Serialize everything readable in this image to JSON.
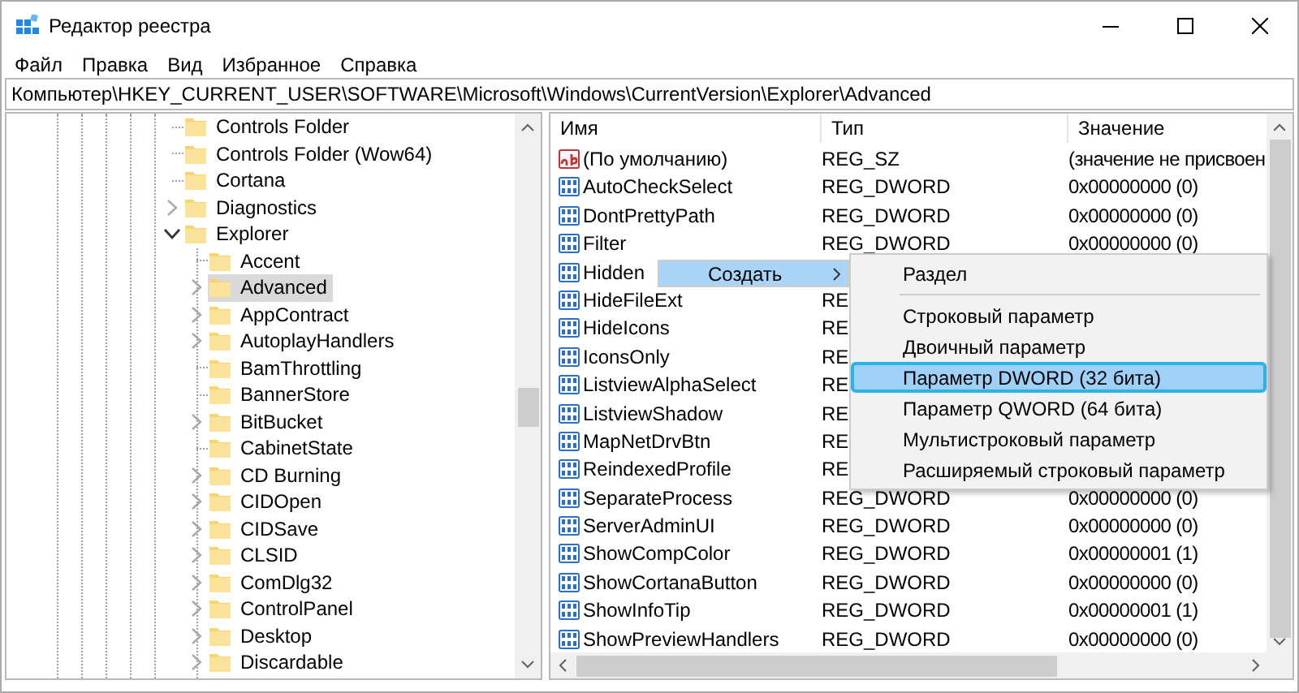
{
  "window": {
    "title": "Редактор реестра"
  },
  "menu": [
    "Файл",
    "Правка",
    "Вид",
    "Избранное",
    "Справка"
  ],
  "address": "Компьютер\\HKEY_CURRENT_USER\\SOFTWARE\\Microsoft\\Windows\\CurrentVersion\\Explorer\\Advanced",
  "tree": [
    {
      "label": "Controls Folder",
      "expandable": false,
      "selected": false
    },
    {
      "label": "Controls Folder (Wow64)",
      "expandable": false,
      "selected": false
    },
    {
      "label": "Cortana",
      "expandable": false,
      "selected": false
    },
    {
      "label": "Diagnostics",
      "expandable": true,
      "expanded": false,
      "selected": false
    },
    {
      "label": "Explorer",
      "expandable": true,
      "expanded": true,
      "selected": false,
      "children": [
        {
          "label": "Accent",
          "expandable": false,
          "selected": false
        },
        {
          "label": "Advanced",
          "expandable": true,
          "expanded": false,
          "selected": true
        },
        {
          "label": "AppContract",
          "expandable": true,
          "expanded": false,
          "selected": false
        },
        {
          "label": "AutoplayHandlers",
          "expandable": true,
          "expanded": false,
          "selected": false
        },
        {
          "label": "BamThrottling",
          "expandable": false,
          "selected": false
        },
        {
          "label": "BannerStore",
          "expandable": false,
          "selected": false
        },
        {
          "label": "BitBucket",
          "expandable": true,
          "expanded": false,
          "selected": false
        },
        {
          "label": "CabinetState",
          "expandable": false,
          "selected": false
        },
        {
          "label": "CD Burning",
          "expandable": true,
          "expanded": false,
          "selected": false
        },
        {
          "label": "CIDOpen",
          "expandable": true,
          "expanded": false,
          "selected": false
        },
        {
          "label": "CIDSave",
          "expandable": true,
          "expanded": false,
          "selected": false
        },
        {
          "label": "CLSID",
          "expandable": true,
          "expanded": false,
          "selected": false
        },
        {
          "label": "ComDlg32",
          "expandable": true,
          "expanded": false,
          "selected": false
        },
        {
          "label": "ControlPanel",
          "expandable": true,
          "expanded": false,
          "selected": false
        },
        {
          "label": "Desktop",
          "expandable": true,
          "expanded": false,
          "selected": false
        },
        {
          "label": "Discardable",
          "expandable": true,
          "expanded": false,
          "selected": false
        }
      ]
    }
  ],
  "table": {
    "columns": [
      "Имя",
      "Тип",
      "Значение"
    ],
    "rows": [
      {
        "kind": "string",
        "name": "(По умолчанию)",
        "type": "REG_SZ",
        "value": "(значение не присвоен"
      },
      {
        "kind": "dword",
        "name": "AutoCheckSelect",
        "type": "REG_DWORD",
        "value": "0x00000000 (0)"
      },
      {
        "kind": "dword",
        "name": "DontPrettyPath",
        "type": "REG_DWORD",
        "value": "0x00000000 (0)"
      },
      {
        "kind": "dword",
        "name": "Filter",
        "type": "REG_DWORD",
        "value": "0x00000000 (0)"
      },
      {
        "kind": "dword",
        "name": "Hidden"
      },
      {
        "kind": "dword",
        "name": "HideFileExt",
        "type": "RE"
      },
      {
        "kind": "dword",
        "name": "HideIcons",
        "type": "RE"
      },
      {
        "kind": "dword",
        "name": "IconsOnly",
        "type": "RE"
      },
      {
        "kind": "dword",
        "name": "ListviewAlphaSelect",
        "type": "RE"
      },
      {
        "kind": "dword",
        "name": "ListviewShadow",
        "type": "RE"
      },
      {
        "kind": "dword",
        "name": "MapNetDrvBtn",
        "type": "RE"
      },
      {
        "kind": "dword",
        "name": "ReindexedProfile",
        "type": "RE"
      },
      {
        "kind": "dword",
        "name": "SeparateProcess",
        "type": "REG_DWORD",
        "value": "0x00000000 (0)"
      },
      {
        "kind": "dword",
        "name": "ServerAdminUI",
        "type": "REG_DWORD",
        "value": "0x00000000 (0)"
      },
      {
        "kind": "dword",
        "name": "ShowCompColor",
        "type": "REG_DWORD",
        "value": "0x00000001 (1)"
      },
      {
        "kind": "dword",
        "name": "ShowCortanaButton",
        "type": "REG_DWORD",
        "value": "0x00000000 (0)"
      },
      {
        "kind": "dword",
        "name": "ShowInfoTip",
        "type": "REG_DWORD",
        "value": "0x00000001 (1)"
      },
      {
        "kind": "dword",
        "name": "ShowPreviewHandlers",
        "type": "REG_DWORD",
        "value": "0x00000000 (0)"
      }
    ]
  },
  "context_menu": {
    "items": [
      {
        "label": "Создать",
        "selected": true,
        "submenu": true
      }
    ]
  },
  "submenu": {
    "items": [
      {
        "kind": "item",
        "label": "Раздел",
        "selected": false
      },
      {
        "kind": "separator"
      },
      {
        "kind": "item",
        "label": "Строковый параметр",
        "selected": false
      },
      {
        "kind": "item",
        "label": "Двоичный параметр",
        "selected": false
      },
      {
        "kind": "item",
        "label": "Параметр DWORD (32 бита)",
        "selected": true
      },
      {
        "kind": "item",
        "label": "Параметр QWORD (64 бита)",
        "selected": false
      },
      {
        "kind": "item",
        "label": "Мультистроковый параметр",
        "selected": false
      },
      {
        "kind": "item",
        "label": "Расширяемый строковый параметр",
        "selected": false
      }
    ]
  }
}
